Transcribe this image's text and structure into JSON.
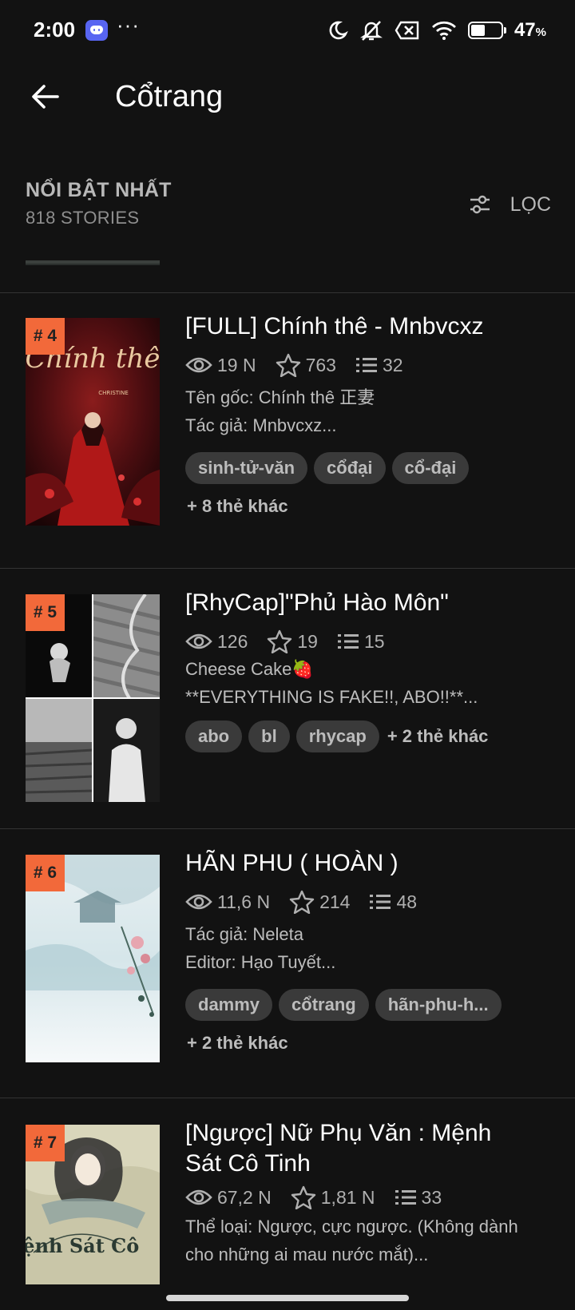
{
  "status_bar": {
    "time": "2:00",
    "dots": "···",
    "battery_percent": "47",
    "battery_level": 0.47,
    "percent_sign": "%"
  },
  "app_bar": {
    "title": "Cổtrang"
  },
  "sort_bar": {
    "title": "NỔI BẬT NHẤT",
    "count": "818 STORIES",
    "filter_label": "LỌC"
  },
  "colors": {
    "background": "#121212",
    "rank_badge": "#f2693a",
    "tag_bg": "#3a3a3a",
    "discord": "#5865F2"
  },
  "stories": [
    {
      "rank": "# 4",
      "title": "[FULL] Chính thê - Mnbvcxz",
      "views": "19 N",
      "votes": "763",
      "parts": "32",
      "desc": [
        "Tên gốc: Chính thê 正妻",
        "Tác giả: Mnbvcxz..."
      ],
      "tags": [
        "sinh-tử-văn",
        "cổđại",
        "cổ-đại"
      ],
      "more_tags": "+ 8 thẻ khác",
      "cover_text": "Chính thê"
    },
    {
      "rank": "# 5",
      "title": "[RhyCap]\"Phủ Hào Môn\"",
      "views": "126",
      "votes": "19",
      "parts": "15",
      "desc": [
        "Cheese Cake🍓",
        "**EVERYTHING IS FAKE!!, ABO!!**..."
      ],
      "tags": [
        "abo",
        "bl",
        "rhycap"
      ],
      "more_tags": "+ 2 thẻ khác"
    },
    {
      "rank": "# 6",
      "title": "HÃN PHU ( HOÀN )",
      "views": "11,6 N",
      "votes": "214",
      "parts": "48",
      "desc": [
        "Tác giả: Neleta",
        "Editor: Hạo Tuyết..."
      ],
      "tags": [
        "dammy",
        "cổtrang",
        "hãn-phu-h..."
      ],
      "more_tags": "+ 2 thẻ khác"
    },
    {
      "rank": "# 7",
      "title_line1": "[Ngược]  Nữ Phụ Văn : Mệnh",
      "title_line2": "Sát Cô Tinh",
      "views": "67,2 N",
      "votes": "1,81 N",
      "parts": "33",
      "desc": [
        "Thể loại: Ngược, cực ngược. (Không dành",
        "cho những ai mau nước mắt)..."
      ],
      "cover_text": "Mệnh Sát Cô"
    }
  ]
}
